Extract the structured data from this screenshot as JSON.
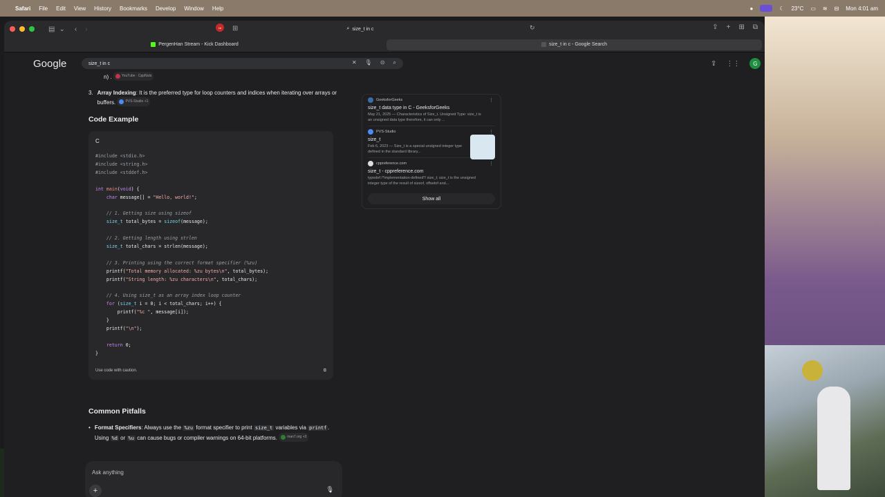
{
  "menubar": {
    "app": "Safari",
    "items": [
      "File",
      "Edit",
      "View",
      "History",
      "Bookmarks",
      "Develop",
      "Window",
      "Help"
    ],
    "temperature": "23°C",
    "datetime": "Mon 4:01 am"
  },
  "browser": {
    "address": "size_t in c",
    "tab_badge": "16",
    "tabs": [
      {
        "label": "PergenHan Stream - Kick Dashboard",
        "active": false
      },
      {
        "label": "size_t in c - Google Search",
        "active": true
      }
    ]
  },
  "google": {
    "logo": "Google",
    "query": "size_t in c",
    "avatar": "G"
  },
  "content": {
    "prev_tail": "n) .",
    "prev_cite": "YouTube · CppNuts",
    "item3_num": "3.",
    "item3_bold": "Array Indexing",
    "item3_text": ": It is the preferred type for loop counters and indices when iterating over arrays or buffers.",
    "item3_cite": "PVS-Studio +1",
    "code_heading": "Code Example",
    "code_lang": "C",
    "code_footer": "Use code with caution.",
    "pitfalls_heading": "Common Pitfalls",
    "pitfall_bold": "Format Specifiers",
    "pitfall_p1": ": Always use the",
    "pitfall_code1": "%zu",
    "pitfall_p2": "format specifier to print",
    "pitfall_code2": "size_t",
    "pitfall_p3": "variables via",
    "pitfall_code3": "printf",
    "pitfall_p4": ". Using",
    "pitfall_code4": "%d",
    "pitfall_p5": "or",
    "pitfall_code5": "%u",
    "pitfall_p6": "can cause bugs or compiler warnings on 64-bit platforms.",
    "pitfall_cite": "man7.org +3"
  },
  "code_lines": [
    "#include <stdio.h>",
    "#include <string.h>",
    "#include <stddef.h>",
    "",
    "int main(void) {",
    "    char message[] = \"Hello, world!\";",
    "",
    "    // 1. Getting size using sizeof",
    "    size_t total_bytes = sizeof(message);",
    "",
    "    // 2. Getting length using strlen",
    "    size_t total_chars = strlen(message);",
    "",
    "    // 3. Printing using the correct format specifier (%zu)",
    "    printf(\"Total memory allocated: %zu bytes\\n\", total_bytes);",
    "    printf(\"String length: %zu characters\\n\", total_chars);",
    "",
    "    // 4. Using size_t as an array index loop counter",
    "    for (size_t i = 0; i < total_chars; i++) {",
    "        printf(\"%c \", message[i]);",
    "    }",
    "    printf(\"\\n\");",
    "",
    "    return 0;",
    "}"
  ],
  "sources": [
    {
      "site": "GeeksforGeeks",
      "title": "size_t data type in C - GeeksforGeeks",
      "desc": "May 21, 2025 — Characteristics of Size_t. Unsigned Type: size_t is an unsigned data type therefore, it can only ..."
    },
    {
      "site": "PVS-Studio",
      "title": "size_t",
      "desc": "Feb 6, 2023 — Size_t is a special unsigned integer type defined in the standard library..."
    },
    {
      "site": "cppreference.com",
      "title": "size_t - cppreference.com",
      "desc": "typedef /*implementation-defined*/ size_t; size_t is the unsigned integer type of the result of sizeof, offsetof and..."
    }
  ],
  "show_all": "Show all",
  "ask": {
    "placeholder": "Ask anything"
  }
}
